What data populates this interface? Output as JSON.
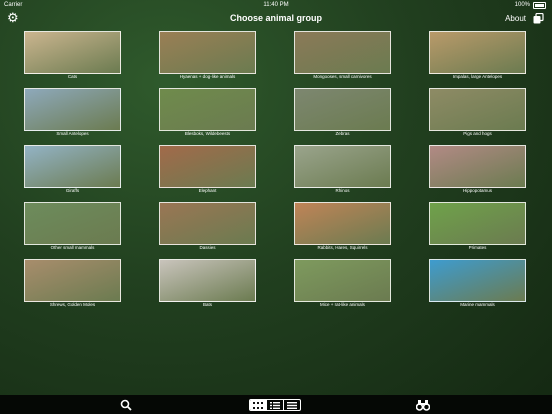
{
  "status": {
    "carrier": "Carrier",
    "time": "11:40 PM",
    "battery": "100%"
  },
  "header": {
    "title": "Choose animal group",
    "about": "About",
    "settings_icon": "gear-icon",
    "copy_icon": "copy-icon"
  },
  "groups": [
    {
      "label": "Cats",
      "color": "#cbb58f"
    },
    {
      "label": "Hyaenas + dog-like animals",
      "color": "#9a7f55"
    },
    {
      "label": "Mongooses, small carnivores",
      "color": "#8b7a58"
    },
    {
      "label": "Impalas, large Antelopes",
      "color": "#b99a6a"
    },
    {
      "label": "Small Antelopes",
      "color": "#8ea9bb"
    },
    {
      "label": "Blesboks, Wildebeests",
      "color": "#6f8b4c"
    },
    {
      "label": "Zebras",
      "color": "#7d8770"
    },
    {
      "label": "Pigs and hogs",
      "color": "#8e8b65"
    },
    {
      "label": "Giraffs",
      "color": "#93b3c5"
    },
    {
      "label": "Elephant",
      "color": "#a26a4a"
    },
    {
      "label": "Rhinos",
      "color": "#9aa48c"
    },
    {
      "label": "Hippopotamus",
      "color": "#b28a85"
    },
    {
      "label": "Other small mammals",
      "color": "#6d8c5c"
    },
    {
      "label": "Dassies",
      "color": "#9a7654"
    },
    {
      "label": "Rabbits, Hares, Squirrels",
      "color": "#c08457"
    },
    {
      "label": "Primates",
      "color": "#6fa24a"
    },
    {
      "label": "Shrews,  Golden Moles",
      "color": "#a88d6c"
    },
    {
      "label": "Bats",
      "color": "#c9c4bc"
    },
    {
      "label": "Mice + rat-like animals",
      "color": "#7e9a5e"
    },
    {
      "label": "Marine mammals",
      "color": "#3e9ccf"
    }
  ],
  "tabbar": {
    "search_icon": "search-icon",
    "view_modes": [
      "grid",
      "list",
      "compact-list"
    ],
    "active_view": "grid",
    "binoculars_icon": "binoculars-icon"
  }
}
